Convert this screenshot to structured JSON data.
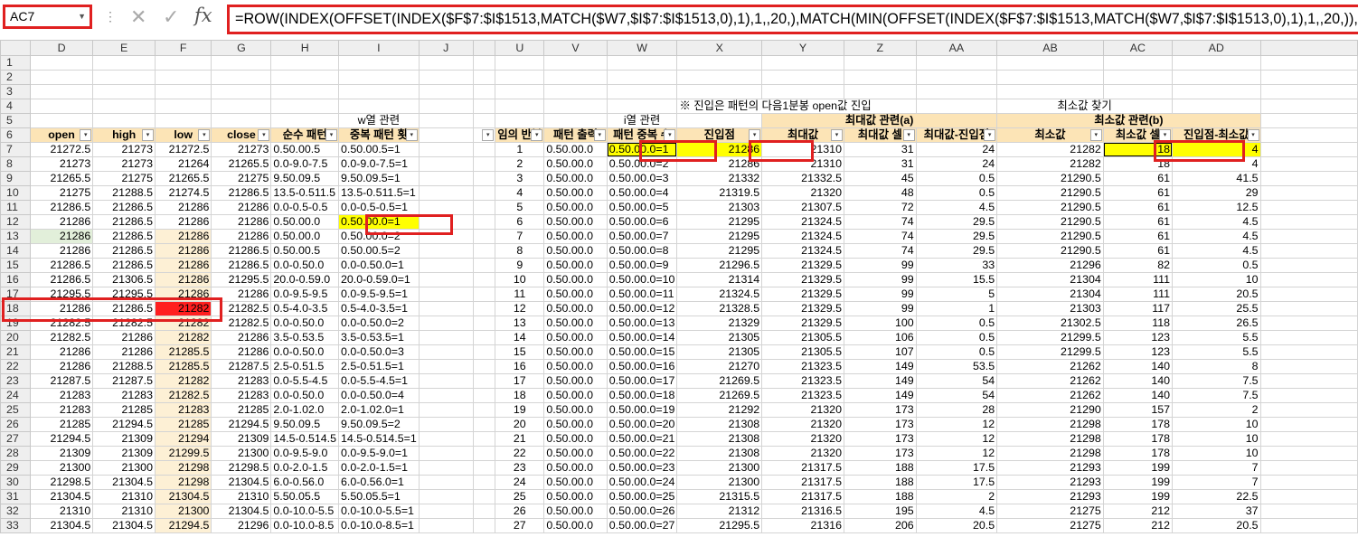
{
  "name_box": "AC7",
  "formula": "=ROW(INDEX(OFFSET(INDEX($F$7:$I$1513,MATCH($W7,$I$7:$I$1513,0),1),1,,20,),MATCH(MIN(OFFSET(INDEX($F$7:$I$1513,MATCH($W7,$I$7:$I$1513,0),1),1,,20,)),OFFSET(INDEX($F$7:$I$",
  "columns": [
    "D",
    "E",
    "F",
    "G",
    "H",
    "I",
    "J",
    "",
    "U",
    "V",
    "W",
    "X",
    "Y",
    "Z",
    "AA",
    "AB",
    "AC",
    "AD"
  ],
  "header_rows": {
    "w_section": "w열 관련",
    "i_section": "i열 관련",
    "note": "※ 진입은 패턴의 다음1분봉 open값 진입",
    "min_find": "최소값 찾기",
    "max_group": "최대값 관련(a)",
    "min_group": "최소값 관련(b)"
  },
  "field_headers": [
    "open",
    "high",
    "low",
    "close",
    "순수 패턴",
    "중복 패턴 횟",
    "",
    "",
    "임의 반복",
    "패턴 출력",
    "패턴 중복 수",
    "진입점",
    "최대값",
    "최대값 셀",
    "최대값-진입점",
    "최소값",
    "최소값 셀",
    "진입점-최소값"
  ],
  "rows": [
    {
      "r": "7",
      "d": "21272.5",
      "e": "21273",
      "f": "21272.5",
      "g": "21273",
      "h": "0.50.00.5",
      "i": "0.50.00.5=1",
      "u": "1",
      "v": "0.50.00.0",
      "w": "0.50.00.0=1",
      "x": "21286",
      "y": "21310",
      "z": "31",
      "aa": "24",
      "ab": "21282",
      "ac": "18",
      "ad": "4"
    },
    {
      "r": "8",
      "d": "21273",
      "e": "21273",
      "f": "21264",
      "g": "21265.5",
      "h": "0.0-9.0-7.5",
      "i": "0.0-9.0-7.5=1",
      "u": "2",
      "v": "0.50.00.0",
      "w": "0.50.00.0=2",
      "x": "21286",
      "y": "21310",
      "z": "31",
      "aa": "24",
      "ab": "21282",
      "ac": "18",
      "ad": "4"
    },
    {
      "r": "9",
      "d": "21265.5",
      "e": "21275",
      "f": "21265.5",
      "g": "21275",
      "h": "9.50.09.5",
      "i": "9.50.09.5=1",
      "u": "3",
      "v": "0.50.00.0",
      "w": "0.50.00.0=3",
      "x": "21332",
      "y": "21332.5",
      "z": "45",
      "aa": "0.5",
      "ab": "21290.5",
      "ac": "61",
      "ad": "41.5"
    },
    {
      "r": "10",
      "d": "21275",
      "e": "21288.5",
      "f": "21274.5",
      "g": "21286.5",
      "h": "13.5-0.511.5",
      "i": "13.5-0.511.5=1",
      "u": "4",
      "v": "0.50.00.0",
      "w": "0.50.00.0=4",
      "x": "21319.5",
      "y": "21320",
      "z": "48",
      "aa": "0.5",
      "ab": "21290.5",
      "ac": "61",
      "ad": "29"
    },
    {
      "r": "11",
      "d": "21286.5",
      "e": "21286.5",
      "f": "21286",
      "g": "21286",
      "h": "0.0-0.5-0.5",
      "i": "0.0-0.5-0.5=1",
      "u": "5",
      "v": "0.50.00.0",
      "w": "0.50.00.0=5",
      "x": "21303",
      "y": "21307.5",
      "z": "72",
      "aa": "4.5",
      "ab": "21290.5",
      "ac": "61",
      "ad": "12.5"
    },
    {
      "r": "12",
      "d": "21286",
      "e": "21286.5",
      "f": "21286",
      "g": "21286",
      "h": "0.50.00.0",
      "i": "0.50.00.0=1",
      "u": "6",
      "v": "0.50.00.0",
      "w": "0.50.00.0=6",
      "x": "21295",
      "y": "21324.5",
      "z": "74",
      "aa": "29.5",
      "ab": "21290.5",
      "ac": "61",
      "ad": "4.5"
    },
    {
      "r": "13",
      "d": "21286",
      "e": "21286.5",
      "f": "21286",
      "g": "21286",
      "h": "0.50.00.0",
      "i": "0.50.00.0=2",
      "u": "7",
      "v": "0.50.00.0",
      "w": "0.50.00.0=7",
      "x": "21295",
      "y": "21324.5",
      "z": "74",
      "aa": "29.5",
      "ab": "21290.5",
      "ac": "61",
      "ad": "4.5"
    },
    {
      "r": "14",
      "d": "21286",
      "e": "21286.5",
      "f": "21286",
      "g": "21286.5",
      "h": "0.50.00.5",
      "i": "0.50.00.5=2",
      "u": "8",
      "v": "0.50.00.0",
      "w": "0.50.00.0=8",
      "x": "21295",
      "y": "21324.5",
      "z": "74",
      "aa": "29.5",
      "ab": "21290.5",
      "ac": "61",
      "ad": "4.5"
    },
    {
      "r": "15",
      "d": "21286.5",
      "e": "21286.5",
      "f": "21286",
      "g": "21286.5",
      "h": "0.0-0.50.0",
      "i": "0.0-0.50.0=1",
      "u": "9",
      "v": "0.50.00.0",
      "w": "0.50.00.0=9",
      "x": "21296.5",
      "y": "21329.5",
      "z": "99",
      "aa": "33",
      "ab": "21296",
      "ac": "82",
      "ad": "0.5"
    },
    {
      "r": "16",
      "d": "21286.5",
      "e": "21306.5",
      "f": "21286",
      "g": "21295.5",
      "h": "20.0-0.59.0",
      "i": "20.0-0.59.0=1",
      "u": "10",
      "v": "0.50.00.0",
      "w": "0.50.00.0=10",
      "x": "21314",
      "y": "21329.5",
      "z": "99",
      "aa": "15.5",
      "ab": "21304",
      "ac": "111",
      "ad": "10"
    },
    {
      "r": "17",
      "d": "21295.5",
      "e": "21295.5",
      "f": "21286",
      "g": "21286",
      "h": "0.0-9.5-9.5",
      "i": "0.0-9.5-9.5=1",
      "u": "11",
      "v": "0.50.00.0",
      "w": "0.50.00.0=11",
      "x": "21324.5",
      "y": "21329.5",
      "z": "99",
      "aa": "5",
      "ab": "21304",
      "ac": "111",
      "ad": "20.5"
    },
    {
      "r": "18",
      "d": "21286",
      "e": "21286.5",
      "f": "21282",
      "g": "21282.5",
      "h": "0.5-4.0-3.5",
      "i": "0.5-4.0-3.5=1",
      "u": "12",
      "v": "0.50.00.0",
      "w": "0.50.00.0=12",
      "x": "21328.5",
      "y": "21329.5",
      "z": "99",
      "aa": "1",
      "ab": "21303",
      "ac": "117",
      "ad": "25.5"
    },
    {
      "r": "19",
      "d": "21282.5",
      "e": "21282.5",
      "f": "21282",
      "g": "21282.5",
      "h": "0.0-0.50.0",
      "i": "0.0-0.50.0=2",
      "u": "13",
      "v": "0.50.00.0",
      "w": "0.50.00.0=13",
      "x": "21329",
      "y": "21329.5",
      "z": "100",
      "aa": "0.5",
      "ab": "21302.5",
      "ac": "118",
      "ad": "26.5"
    },
    {
      "r": "20",
      "d": "21282.5",
      "e": "21286",
      "f": "21282",
      "g": "21286",
      "h": "3.5-0.53.5",
      "i": "3.5-0.53.5=1",
      "u": "14",
      "v": "0.50.00.0",
      "w": "0.50.00.0=14",
      "x": "21305",
      "y": "21305.5",
      "z": "106",
      "aa": "0.5",
      "ab": "21299.5",
      "ac": "123",
      "ad": "5.5"
    },
    {
      "r": "21",
      "d": "21286",
      "e": "21286",
      "f": "21285.5",
      "g": "21286",
      "h": "0.0-0.50.0",
      "i": "0.0-0.50.0=3",
      "u": "15",
      "v": "0.50.00.0",
      "w": "0.50.00.0=15",
      "x": "21305",
      "y": "21305.5",
      "z": "107",
      "aa": "0.5",
      "ab": "21299.5",
      "ac": "123",
      "ad": "5.5"
    },
    {
      "r": "22",
      "d": "21286",
      "e": "21288.5",
      "f": "21285.5",
      "g": "21287.5",
      "h": "2.5-0.51.5",
      "i": "2.5-0.51.5=1",
      "u": "16",
      "v": "0.50.00.0",
      "w": "0.50.00.0=16",
      "x": "21270",
      "y": "21323.5",
      "z": "149",
      "aa": "53.5",
      "ab": "21262",
      "ac": "140",
      "ad": "8"
    },
    {
      "r": "23",
      "d": "21287.5",
      "e": "21287.5",
      "f": "21282",
      "g": "21283",
      "h": "0.0-5.5-4.5",
      "i": "0.0-5.5-4.5=1",
      "u": "17",
      "v": "0.50.00.0",
      "w": "0.50.00.0=17",
      "x": "21269.5",
      "y": "21323.5",
      "z": "149",
      "aa": "54",
      "ab": "21262",
      "ac": "140",
      "ad": "7.5"
    },
    {
      "r": "24",
      "d": "21283",
      "e": "21283",
      "f": "21282.5",
      "g": "21283",
      "h": "0.0-0.50.0",
      "i": "0.0-0.50.0=4",
      "u": "18",
      "v": "0.50.00.0",
      "w": "0.50.00.0=18",
      "x": "21269.5",
      "y": "21323.5",
      "z": "149",
      "aa": "54",
      "ab": "21262",
      "ac": "140",
      "ad": "7.5"
    },
    {
      "r": "25",
      "d": "21283",
      "e": "21285",
      "f": "21283",
      "g": "21285",
      "h": "2.0-1.02.0",
      "i": "2.0-1.02.0=1",
      "u": "19",
      "v": "0.50.00.0",
      "w": "0.50.00.0=19",
      "x": "21292",
      "y": "21320",
      "z": "173",
      "aa": "28",
      "ab": "21290",
      "ac": "157",
      "ad": "2"
    },
    {
      "r": "26",
      "d": "21285",
      "e": "21294.5",
      "f": "21285",
      "g": "21294.5",
      "h": "9.50.09.5",
      "i": "9.50.09.5=2",
      "u": "20",
      "v": "0.50.00.0",
      "w": "0.50.00.0=20",
      "x": "21308",
      "y": "21320",
      "z": "173",
      "aa": "12",
      "ab": "21298",
      "ac": "178",
      "ad": "10"
    },
    {
      "r": "27",
      "d": "21294.5",
      "e": "21309",
      "f": "21294",
      "g": "21309",
      "h": "14.5-0.514.5",
      "i": "14.5-0.514.5=1",
      "u": "21",
      "v": "0.50.00.0",
      "w": "0.50.00.0=21",
      "x": "21308",
      "y": "21320",
      "z": "173",
      "aa": "12",
      "ab": "21298",
      "ac": "178",
      "ad": "10"
    },
    {
      "r": "28",
      "d": "21309",
      "e": "21309",
      "f": "21299.5",
      "g": "21300",
      "h": "0.0-9.5-9.0",
      "i": "0.0-9.5-9.0=1",
      "u": "22",
      "v": "0.50.00.0",
      "w": "0.50.00.0=22",
      "x": "21308",
      "y": "21320",
      "z": "173",
      "aa": "12",
      "ab": "21298",
      "ac": "178",
      "ad": "10"
    },
    {
      "r": "29",
      "d": "21300",
      "e": "21300",
      "f": "21298",
      "g": "21298.5",
      "h": "0.0-2.0-1.5",
      "i": "0.0-2.0-1.5=1",
      "u": "23",
      "v": "0.50.00.0",
      "w": "0.50.00.0=23",
      "x": "21300",
      "y": "21317.5",
      "z": "188",
      "aa": "17.5",
      "ab": "21293",
      "ac": "199",
      "ad": "7"
    },
    {
      "r": "30",
      "d": "21298.5",
      "e": "21304.5",
      "f": "21298",
      "g": "21304.5",
      "h": "6.0-0.56.0",
      "i": "6.0-0.56.0=1",
      "u": "24",
      "v": "0.50.00.0",
      "w": "0.50.00.0=24",
      "x": "21300",
      "y": "21317.5",
      "z": "188",
      "aa": "17.5",
      "ab": "21293",
      "ac": "199",
      "ad": "7"
    },
    {
      "r": "31",
      "d": "21304.5",
      "e": "21310",
      "f": "21304.5",
      "g": "21310",
      "h": "5.50.05.5",
      "i": "5.50.05.5=1",
      "u": "25",
      "v": "0.50.00.0",
      "w": "0.50.00.0=25",
      "x": "21315.5",
      "y": "21317.5",
      "z": "188",
      "aa": "2",
      "ab": "21293",
      "ac": "199",
      "ad": "22.5"
    },
    {
      "r": "32",
      "d": "21310",
      "e": "21310",
      "f": "21300",
      "g": "21304.5",
      "h": "0.0-10.0-5.5",
      "i": "0.0-10.0-5.5=1",
      "u": "26",
      "v": "0.50.00.0",
      "w": "0.50.00.0=26",
      "x": "21312",
      "y": "21316.5",
      "z": "195",
      "aa": "4.5",
      "ab": "21275",
      "ac": "212",
      "ad": "37"
    },
    {
      "r": "33",
      "d": "21304.5",
      "e": "21304.5",
      "f": "21294.5",
      "g": "21296",
      "h": "0.0-10.0-8.5",
      "i": "0.0-10.0-8.5=1",
      "u": "27",
      "v": "0.50.00.0",
      "w": "0.50.00.0=27",
      "x": "21295.5",
      "y": "21316",
      "z": "206",
      "aa": "20.5",
      "ab": "21275",
      "ac": "212",
      "ad": "20.5"
    }
  ],
  "colors": {
    "highlight": "#ffff00",
    "alert": "#ff1f1f",
    "header": "#fce4b6",
    "annotation": "#e02020"
  }
}
